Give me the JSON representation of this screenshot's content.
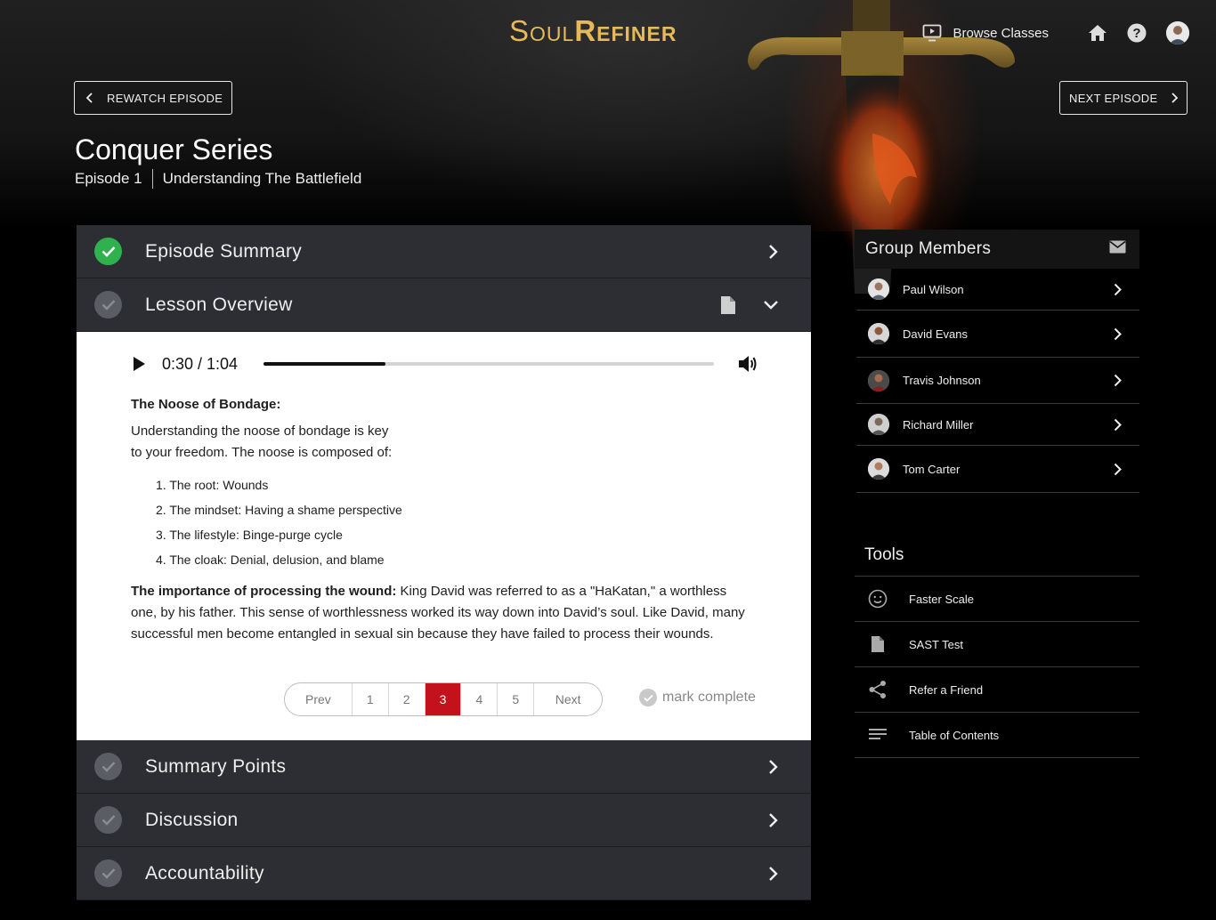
{
  "brand": {
    "logo_part1": "Soul",
    "logo_part2": "Refiner"
  },
  "topnav": {
    "browse_label": "Browse Classes"
  },
  "episode_nav": {
    "rewatch_label": "REWATCH EPISODE",
    "next_label": "NEXT EPISODE"
  },
  "series": {
    "title": "Conquer Series",
    "episode": "Episode 1",
    "episode_title": "Understanding The Battlefield"
  },
  "accordion": {
    "open_section": "Lesson Overview",
    "sections": [
      {
        "label": "Episode Summary",
        "completed": true
      },
      {
        "label": "Lesson Overview",
        "completed": false
      },
      {
        "label": "Summary Points",
        "completed": false
      },
      {
        "label": "Discussion",
        "completed": false
      },
      {
        "label": "Accountability",
        "completed": false
      }
    ]
  },
  "player": {
    "time": "0:30 / 1:04",
    "progress": 0.27
  },
  "lesson": {
    "heading": "The Noose of Bondage:",
    "intro_line1": "Understanding the noose of bondage is key",
    "intro_line2": "to your freedom. The noose is composed of:",
    "list": [
      "1. The root: Wounds",
      "2. The mindset: Having a shame perspective",
      "3. The lifestyle: Binge-purge cycle",
      "4. The cloak: Denial, delusion, and blame"
    ],
    "para_bold": "The importance of processing the wound:",
    "para_text": " King David was referred to as a \"HaKatan,\" a worthless one, by his father. This sense of worthlessness worked its way down into David’s soul. Like David, many successful men become entangled in sexual sin because they have failed to process their wounds."
  },
  "pagination": {
    "prev": "Prev",
    "next": "Next",
    "pages": [
      "1",
      "2",
      "3",
      "4",
      "5"
    ],
    "current": "3"
  },
  "mark_complete_label": "mark complete",
  "group_members": {
    "title": "Group Members",
    "members": [
      "Paul Wilson",
      "David Evans",
      "Travis Johnson",
      "Richard Miller",
      "Tom Carter"
    ]
  },
  "tools": {
    "title": "Tools",
    "items": [
      {
        "label": "Faster Scale",
        "icon": "smiley-icon"
      },
      {
        "label": "SAST Test",
        "icon": "document-icon"
      },
      {
        "label": "Refer a Friend",
        "icon": "share-icon"
      },
      {
        "label": "Table of Contents",
        "icon": "list-icon"
      }
    ]
  },
  "colors": {
    "logo_gold": "#e6b95a",
    "complete_green": "#2fb24d",
    "pager_active": "#c3121b",
    "accordion_bg": "#2c2e33"
  }
}
